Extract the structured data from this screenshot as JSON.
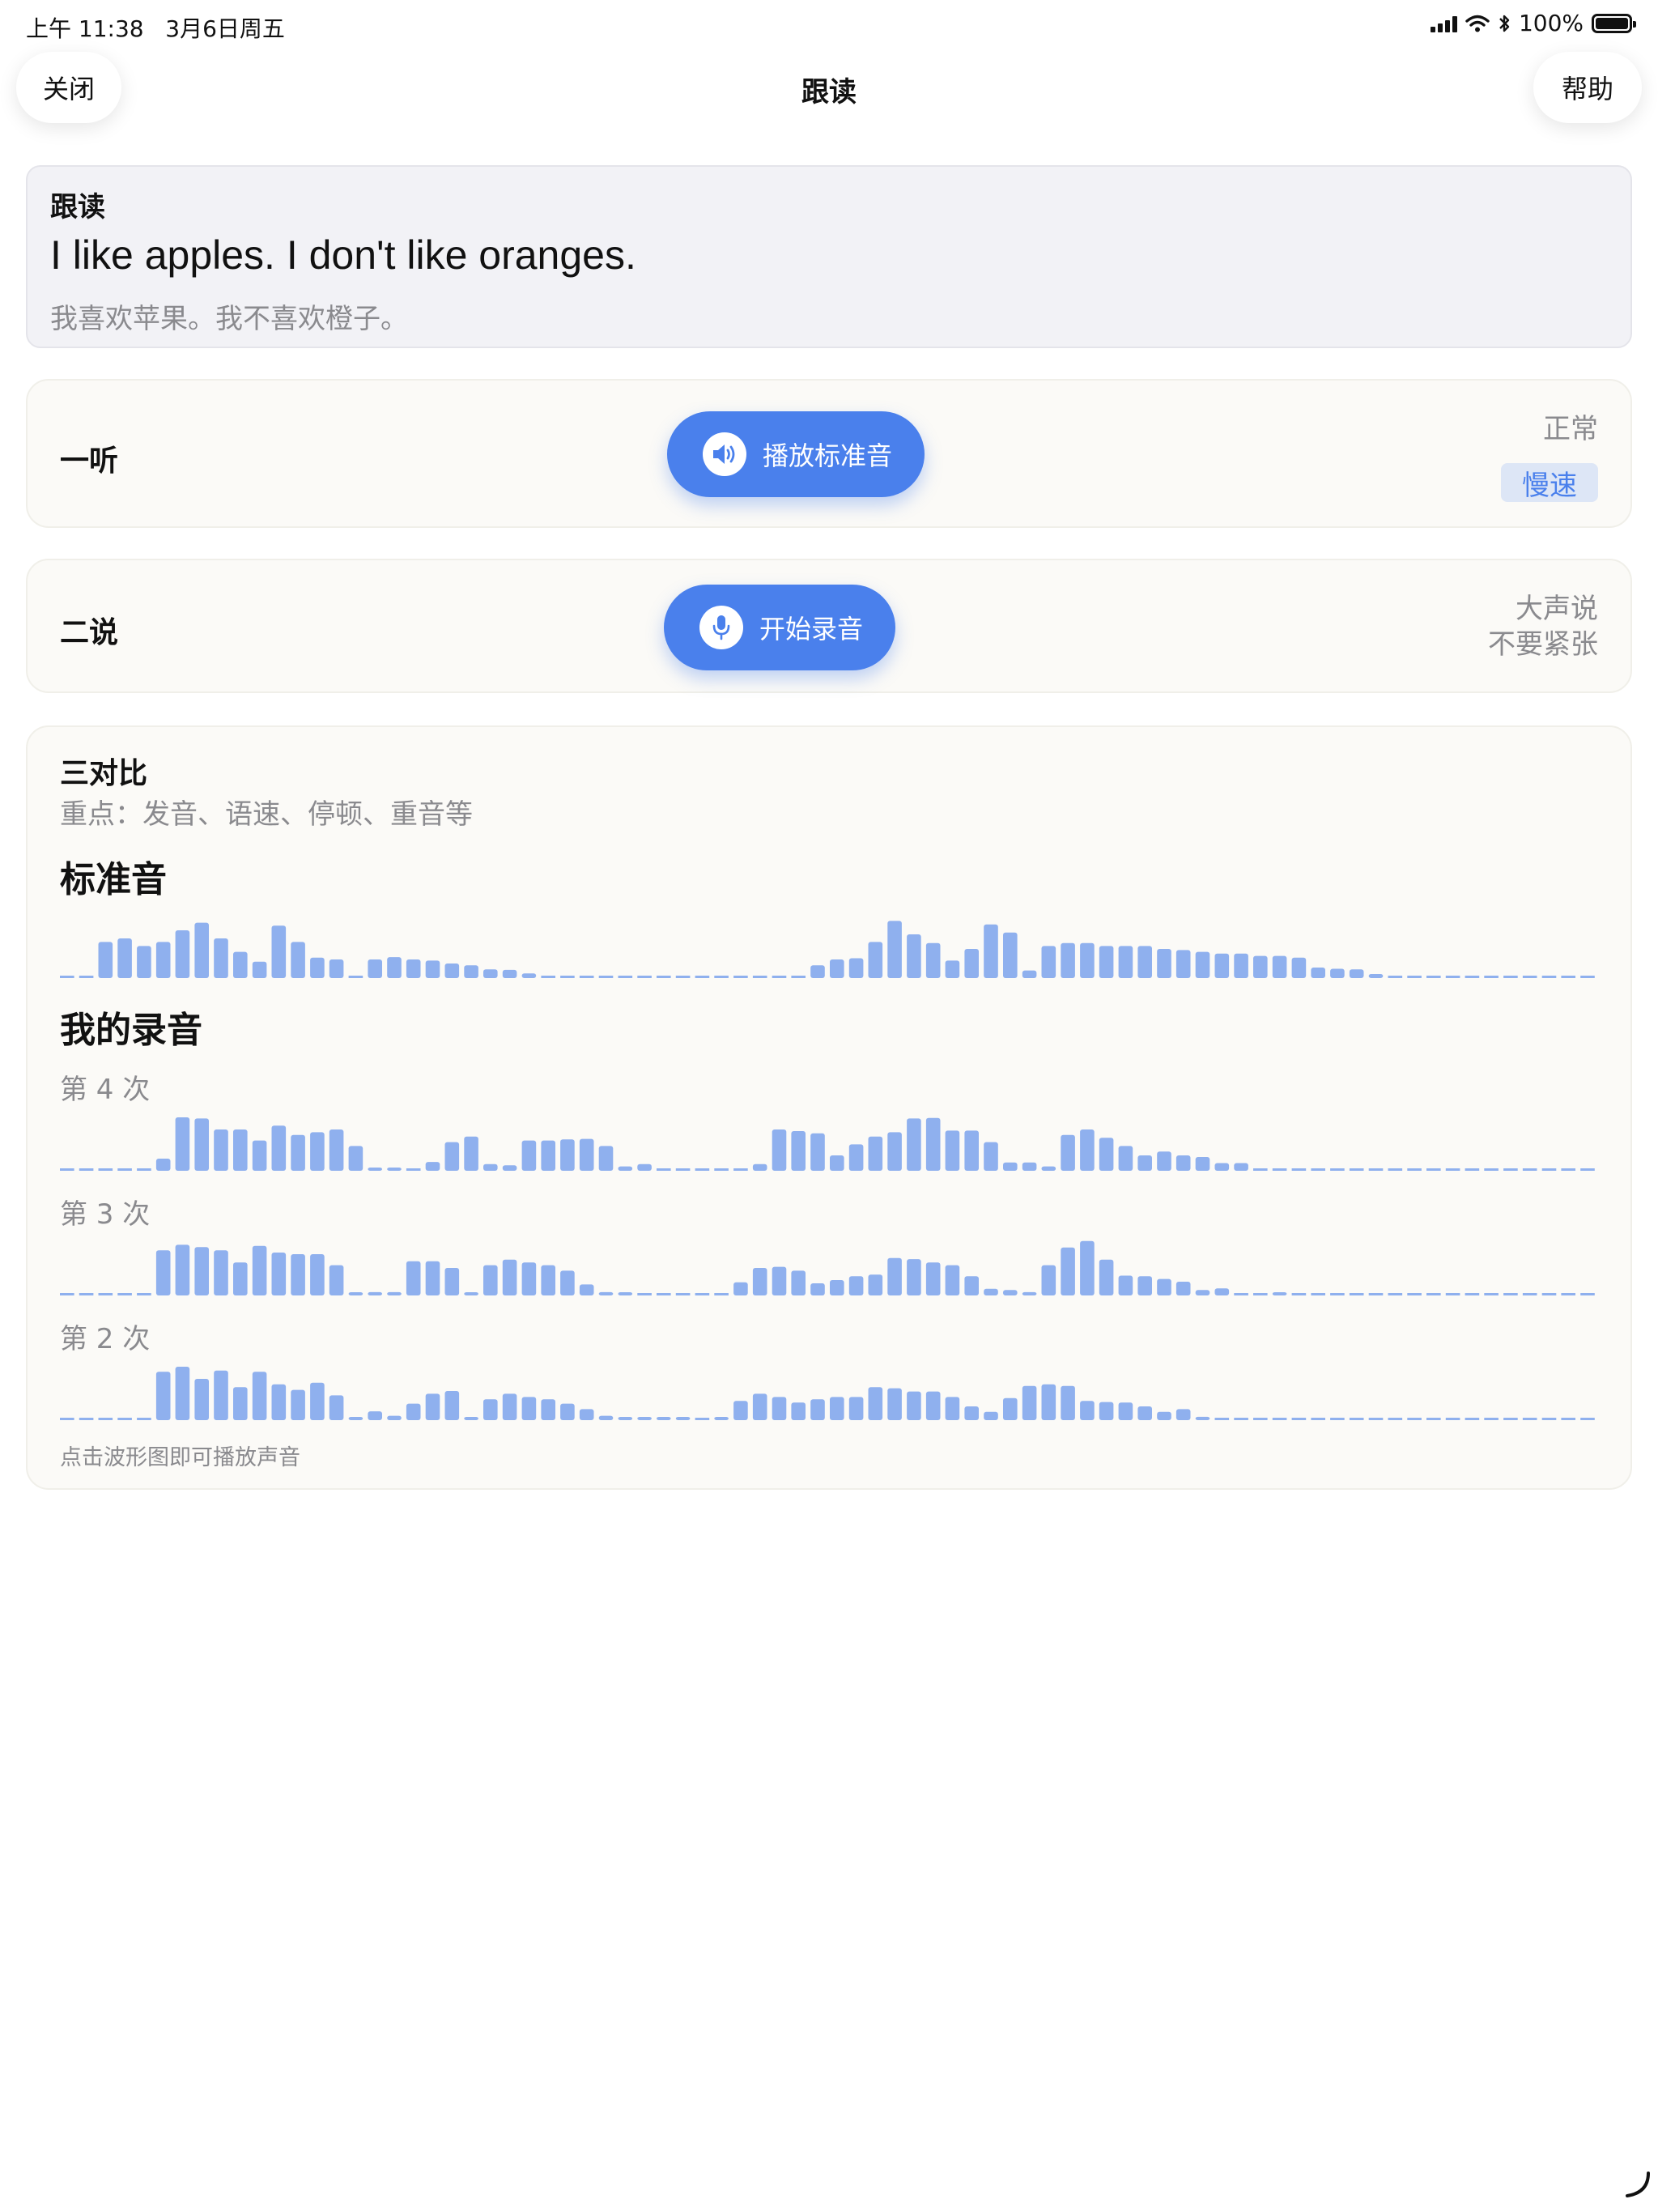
{
  "status_bar": {
    "time_date": "上午 11:38   3月6日周五",
    "battery_text": "100%"
  },
  "nav": {
    "close_label": "关闭",
    "title": "跟读",
    "help_label": "帮助"
  },
  "sentence": {
    "title": "跟读",
    "english": "I like apples. I don't like oranges.",
    "chinese": "我喜欢苹果。我不喜欢橙子。"
  },
  "listen": {
    "label": "一听",
    "play_button_label": "播放标准音",
    "play_button_icon": "speaker-icon",
    "speed_normal": "正常",
    "speed_slow": "慢速",
    "selected_speed": "慢速"
  },
  "speak": {
    "label": "二说",
    "record_button_label": "开始录音",
    "record_button_icon": "microphone-icon",
    "hint_line1": "大声说",
    "hint_line2": "不要紧张"
  },
  "compare": {
    "title": "三对比",
    "focus": "重点：发音、语速、停顿、重音等",
    "standard_heading": "标准音",
    "recording_heading": "我的录音",
    "attempt_labels": [
      "第 4 次",
      "第 3 次",
      "第 2 次"
    ],
    "tap_hint": "点击波形图即可播放声音"
  },
  "colors": {
    "accent": "#4a80ec",
    "waveform": "#8fb0ee",
    "muted_text": "#8a8a8e"
  },
  "waveforms": {
    "standard": [
      0,
      0,
      0.62,
      0.68,
      0.55,
      0.62,
      0.82,
      0.95,
      0.68,
      0.45,
      0.28,
      0.9,
      0.62,
      0.35,
      0.32,
      0,
      0.32,
      0.36,
      0.32,
      0.3,
      0.25,
      0.22,
      0.15,
      0.14,
      0.08,
      0,
      0,
      0,
      0,
      0,
      0,
      0,
      0,
      0,
      0,
      0,
      0,
      0,
      0,
      0.22,
      0.32,
      0.34,
      0.62,
      0.98,
      0.75,
      0.6,
      0.3,
      0.5,
      0.92,
      0.78,
      0.13,
      0.55,
      0.6,
      0.6,
      0.55,
      0.55,
      0.55,
      0.5,
      0.48,
      0.45,
      0.42,
      0.42,
      0.38,
      0.38,
      0.35,
      0.18,
      0.16,
      0.15,
      0.07,
      0,
      0,
      0,
      0,
      0,
      0,
      0,
      0,
      0,
      0,
      0
    ],
    "attempt_4": [
      0,
      0,
      0,
      0,
      0,
      0.22,
      0.97,
      0.95,
      0.75,
      0.75,
      0.55,
      0.82,
      0.65,
      0.7,
      0.75,
      0.45,
      0.05,
      0.04,
      0.02,
      0.16,
      0.52,
      0.62,
      0.12,
      0.1,
      0.55,
      0.55,
      0.57,
      0.58,
      0.45,
      0.08,
      0.12,
      0,
      0,
      0,
      0,
      0,
      0.12,
      0.75,
      0.72,
      0.68,
      0.28,
      0.48,
      0.62,
      0.7,
      0.95,
      0.96,
      0.73,
      0.73,
      0.52,
      0.15,
      0.15,
      0.08,
      0.65,
      0.75,
      0.6,
      0.45,
      0.28,
      0.35,
      0.28,
      0.25,
      0.14,
      0.14,
      0,
      0,
      0,
      0,
      0,
      0,
      0,
      0,
      0,
      0,
      0,
      0,
      0,
      0,
      0,
      0,
      0,
      0
    ],
    "attempt_3": [
      0,
      0,
      0,
      0,
      0,
      0.82,
      0.92,
      0.88,
      0.82,
      0.6,
      0.9,
      0.78,
      0.75,
      0.75,
      0.55,
      0.05,
      0.06,
      0.06,
      0.62,
      0.62,
      0.5,
      0.05,
      0.55,
      0.65,
      0.6,
      0.55,
      0.45,
      0.2,
      0.06,
      0.04,
      0.03,
      0.03,
      0.02,
      0.02,
      0.02,
      0.24,
      0.5,
      0.52,
      0.45,
      0.22,
      0.28,
      0.35,
      0.38,
      0.68,
      0.66,
      0.6,
      0.55,
      0.35,
      0.12,
      0.1,
      0.06,
      0.55,
      0.87,
      0.99,
      0.65,
      0.36,
      0.35,
      0.3,
      0.25,
      0.1,
      0.13,
      0,
      0,
      0.05,
      0,
      0,
      0,
      0,
      0,
      0,
      0,
      0,
      0,
      0,
      0,
      0,
      0,
      0,
      0,
      0
    ],
    "attempt_2": [
      0,
      0,
      0,
      0,
      0,
      0.88,
      0.97,
      0.75,
      0.9,
      0.6,
      0.88,
      0.65,
      0.55,
      0.68,
      0.45,
      0.05,
      0.16,
      0.08,
      0.3,
      0.48,
      0.53,
      0.05,
      0.38,
      0.48,
      0.42,
      0.38,
      0.3,
      0.2,
      0.08,
      0.05,
      0.05,
      0.04,
      0.04,
      0.03,
      0.04,
      0.35,
      0.48,
      0.42,
      0.32,
      0.38,
      0.42,
      0.42,
      0.6,
      0.58,
      0.52,
      0.52,
      0.42,
      0.25,
      0.15,
      0.4,
      0.62,
      0.65,
      0.62,
      0.35,
      0.33,
      0.32,
      0.25,
      0.15,
      0.2,
      0.06,
      0,
      0,
      0,
      0,
      0,
      0,
      0,
      0,
      0,
      0,
      0,
      0,
      0,
      0,
      0,
      0,
      0,
      0,
      0,
      0
    ]
  }
}
